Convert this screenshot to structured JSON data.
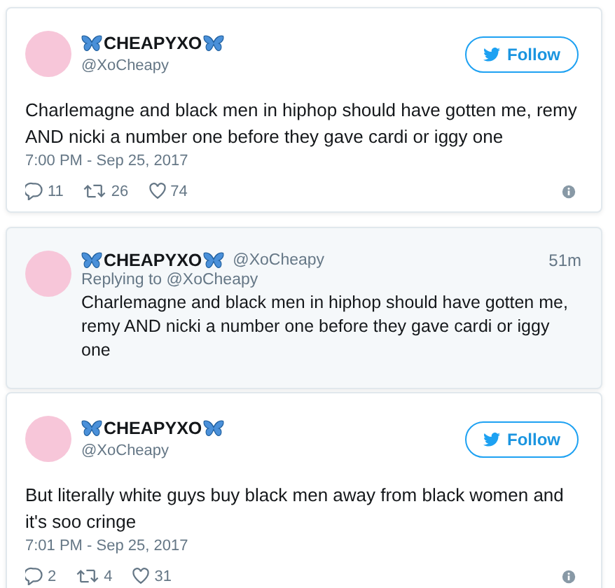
{
  "tweets": [
    {
      "kind": "embed",
      "name": "CHEAPYXO",
      "handle": "@XoCheapy",
      "follow": "Follow",
      "text": "Charlemagne and black men in hiphop should have gotten me, remy AND nicki a number one before they gave cardi or iggy one",
      "time": "7:00 PM - Sep 25, 2017",
      "replies": "11",
      "retweets": "26",
      "likes": "74"
    },
    {
      "kind": "reply",
      "name": "CHEAPYXO",
      "handle": "@XoCheapy",
      "age": "51m",
      "replying_to": "Replying to @XoCheapy",
      "text": "Charlemagne and black men in hiphop should have gotten me, remy AND nicki a number one before they gave cardi or iggy one"
    },
    {
      "kind": "embed",
      "name": "CHEAPYXO",
      "handle": "@XoCheapy",
      "follow": "Follow",
      "text": "But literally white guys buy black men away from black women and it's soo cringe",
      "time": "7:01 PM - Sep 25, 2017",
      "replies": "2",
      "retweets": "4",
      "likes": "31"
    }
  ]
}
